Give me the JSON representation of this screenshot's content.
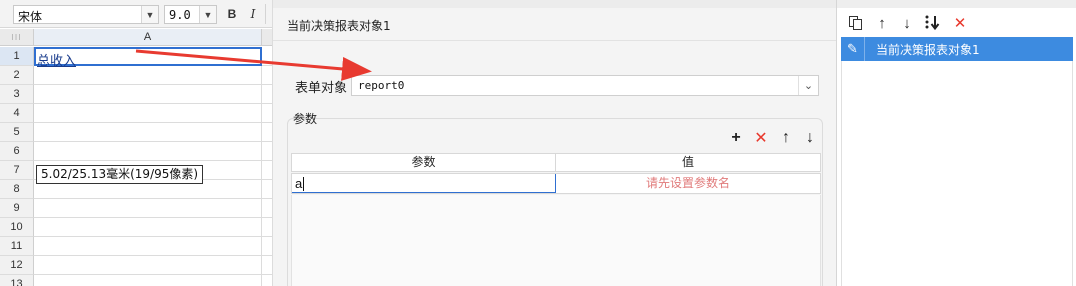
{
  "toolbar": {
    "font_family": "宋体",
    "font_size": "9.0",
    "bold_label": "B",
    "italic_label": "I"
  },
  "sheet": {
    "column_header": "A",
    "rows": [
      "1",
      "2",
      "3",
      "4",
      "5",
      "6",
      "7",
      "8",
      "9",
      "10",
      "11",
      "12",
      "13"
    ],
    "cell_a1": "总收入",
    "size_tooltip": "5.02/25.13毫米(19/95像素)"
  },
  "dialog": {
    "title": "当前决策报表对象1",
    "form_object_label": "表单对象",
    "form_object_value": "report0",
    "params_section_label": "参数",
    "params_table": {
      "headers": [
        "参数",
        "值"
      ],
      "rows": [
        {
          "param": "a",
          "value_placeholder": "请先设置参数名"
        }
      ]
    }
  },
  "right_panel": {
    "items": [
      "当前决策报表对象1"
    ]
  },
  "colors": {
    "selection_blue": "#3d8be0",
    "arrow_red": "#e83a30",
    "placeholder_red": "#e07a7a"
  }
}
